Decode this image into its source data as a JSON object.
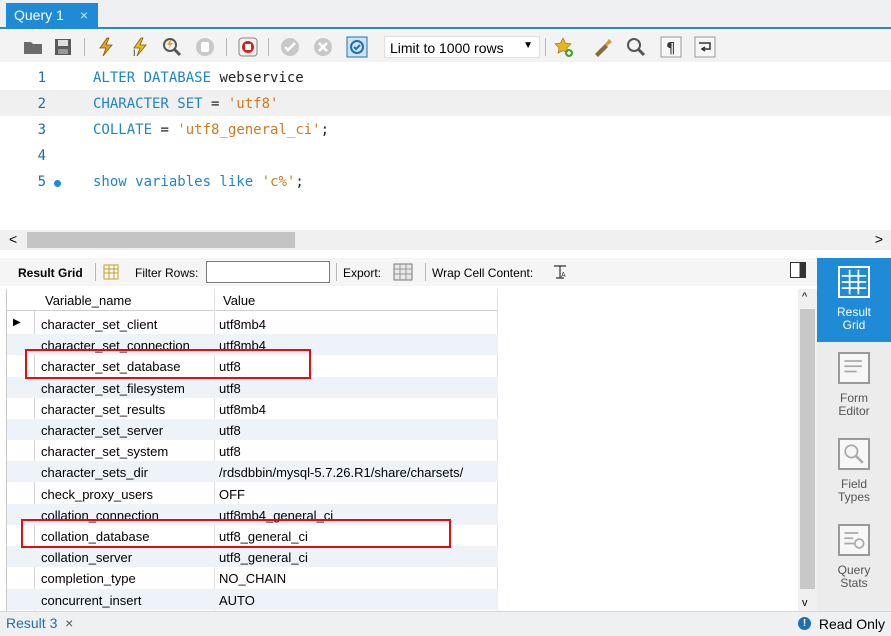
{
  "query_tab": {
    "label": "Query 1",
    "close": "×"
  },
  "toolbar": {
    "limit_select": "Limit to 1000 rows",
    "icons": [
      "open-folder-icon",
      "save-icon",
      "execute-icon",
      "execute-current-icon",
      "explain-icon",
      "stop-icon",
      "toggle-errors-icon",
      "commit-icon",
      "rollback-icon",
      "autocommit-icon",
      "add-snippet-icon",
      "beautify-icon",
      "find-icon",
      "invisible-chars-icon",
      "wrap-icon"
    ]
  },
  "editor": {
    "lines": [
      {
        "num": "1",
        "kw": "ALTER DATABASE",
        "rest": " webservice",
        "str": "",
        "tail": ""
      },
      {
        "num": "2",
        "kw": "CHARACTER SET",
        "rest": " = ",
        "str": "'utf8'",
        "tail": ""
      },
      {
        "num": "3",
        "kw": "COLLATE",
        "rest": " = ",
        "str": "'utf8_general_ci'",
        "tail": ";"
      },
      {
        "num": "4",
        "kw": "",
        "rest": "",
        "str": "",
        "tail": ""
      },
      {
        "num": "5",
        "kw": "show variables like",
        "rest": " ",
        "str": "'c%'",
        "tail": ";"
      }
    ]
  },
  "scroll": {
    "left": "<",
    "right": ">",
    "up": "^",
    "down": "v"
  },
  "result_toolbar": {
    "result_grid": "Result Grid",
    "filter_rows": "Filter Rows:",
    "export": "Export:",
    "wrap": "Wrap Cell Content:"
  },
  "grid": {
    "columns": [
      "Variable_name",
      "Value"
    ],
    "rows": [
      [
        "character_set_client",
        "utf8mb4"
      ],
      [
        "character_set_connection",
        "utf8mb4"
      ],
      [
        "character_set_database",
        "utf8"
      ],
      [
        "character_set_filesystem",
        "utf8"
      ],
      [
        "character_set_results",
        "utf8mb4"
      ],
      [
        "character_set_server",
        "utf8"
      ],
      [
        "character_set_system",
        "utf8"
      ],
      [
        "character_sets_dir",
        "/rdsdbbin/mysql-5.7.26.R1/share/charsets/"
      ],
      [
        "check_proxy_users",
        "OFF"
      ],
      [
        "collation_connection",
        "utf8mb4_general_ci"
      ],
      [
        "collation_database",
        "utf8_general_ci"
      ],
      [
        "collation_server",
        "utf8_general_ci"
      ],
      [
        "completion_type",
        "NO_CHAIN"
      ],
      [
        "concurrent_insert",
        "AUTO"
      ]
    ]
  },
  "side_panel": {
    "items": [
      {
        "line1": "Result",
        "line2": "Grid"
      },
      {
        "line1": "Form",
        "line2": "Editor"
      },
      {
        "line1": "Field",
        "line2": "Types"
      },
      {
        "line1": "Query",
        "line2": "Stats"
      }
    ]
  },
  "status": {
    "result_tab": "Result 3",
    "close": "×",
    "info": "!",
    "read_only": "Read Only"
  },
  "colors": {
    "accent": "#1f8ad6",
    "highlight_box": "#e01010",
    "keyword": "#1f86c4",
    "string": "#d07a1e"
  }
}
